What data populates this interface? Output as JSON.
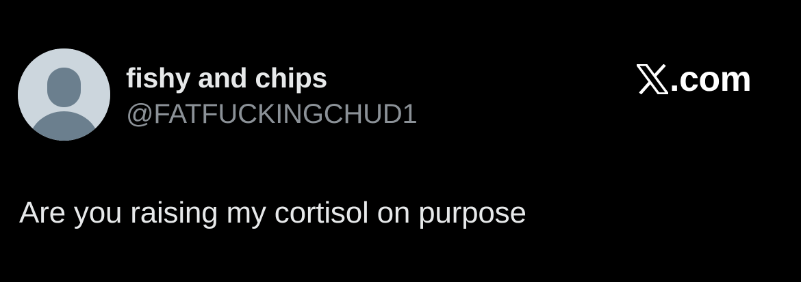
{
  "author": {
    "display_name": "fishy and chips",
    "handle": "@FATFUCKINGCHUD1",
    "avatar_icon": "default-profile-silhouette-icon"
  },
  "brand": {
    "logo_icon": "x-logo-icon",
    "suffix": ".com"
  },
  "tweet": {
    "text": "Are you raising my cortisol on purpose"
  },
  "colors": {
    "background": "#000000",
    "primary_text": "#e7e9ea",
    "secondary_text": "#8b9197",
    "avatar_bg": "#ccd6dd",
    "avatar_silhouette": "#6b7f8e"
  }
}
